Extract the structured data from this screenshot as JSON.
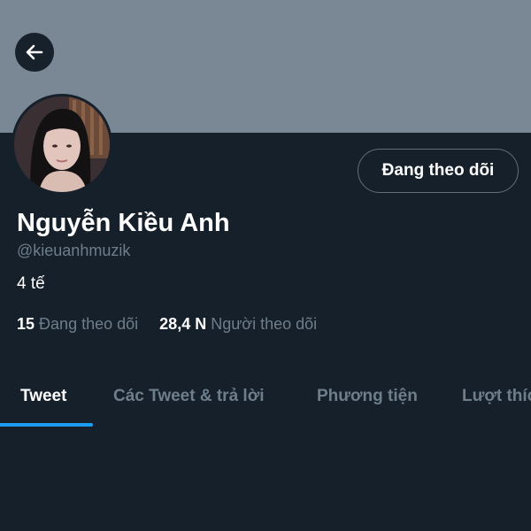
{
  "profile": {
    "display_name": "Nguyễn Kiều Anh",
    "handle": "@kieuanhmuzik",
    "bio": "4 tế"
  },
  "follow_button": {
    "label": "Đang theo dõi"
  },
  "stats": {
    "following_count": "15",
    "following_label": "Đang theo dõi",
    "followers_count": "28,4 N",
    "followers_label": "Người theo dõi"
  },
  "tabs": [
    {
      "label": "Tweet",
      "active": true
    },
    {
      "label": "Các Tweet & trả lời",
      "active": false
    },
    {
      "label": "Phương tiện",
      "active": false
    },
    {
      "label": "Lượt thích",
      "active": false
    }
  ],
  "icons": {
    "back": "arrow-left-icon",
    "avatar": "profile-photo"
  },
  "colors": {
    "background": "#15202b",
    "banner": "#7a8794",
    "secondary_text": "#6e7e8b",
    "accent": "#1d9bf0"
  }
}
